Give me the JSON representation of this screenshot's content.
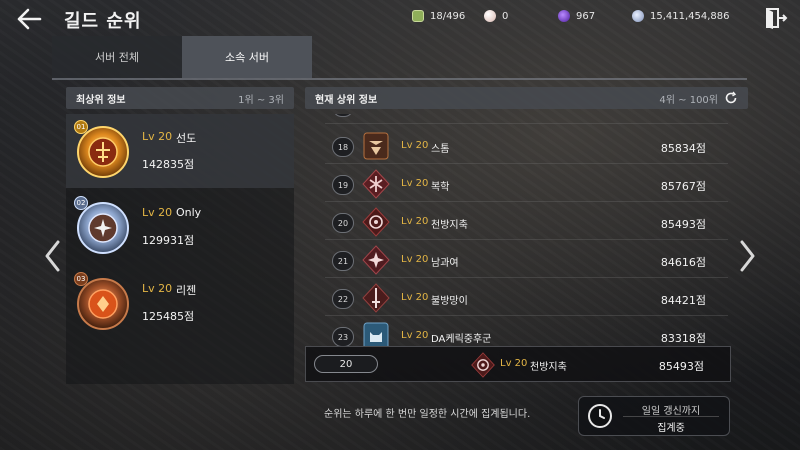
{
  "header": {
    "title": "길드 순위",
    "resources": [
      {
        "icon": "guild-member-icon",
        "value": "18/496",
        "color": "#8fae5a"
      },
      {
        "icon": "pearl-icon",
        "value": "0",
        "color": "#e8d7d2"
      },
      {
        "icon": "purple-gem-icon",
        "value": "967",
        "color": "#7a3fcf"
      },
      {
        "icon": "silver-coin-icon",
        "value": "15,411,454,886",
        "color": "#a9b8d6"
      }
    ]
  },
  "tabs": [
    {
      "label": "서버 전체",
      "active": false
    },
    {
      "label": "소속 서버",
      "active": true
    }
  ],
  "top_panel": {
    "title": "최상위 정보",
    "range": "1위 ~ 3위",
    "entries": [
      {
        "rank": "01",
        "level": "Lv 20",
        "name": "선도",
        "score": "142835점",
        "emblem": "gold-emblem-icon"
      },
      {
        "rank": "02",
        "level": "Lv 20",
        "name": "Only",
        "score": "129931점",
        "emblem": "silver-emblem-icon"
      },
      {
        "rank": "03",
        "level": "Lv 20",
        "name": "리젠",
        "score": "125485점",
        "emblem": "bronze-emblem-icon"
      }
    ]
  },
  "ranking_panel": {
    "title": "현재 상위 정보",
    "range": "4위 ~ 100위",
    "partial_top_rank": "18",
    "rows": [
      {
        "rank": "18",
        "level": "Lv 20",
        "name": "스톰",
        "score": "85834점",
        "emblem": "storm-emblem-icon"
      },
      {
        "rank": "19",
        "level": "Lv 20",
        "name": "복학",
        "score": "85767점",
        "emblem": "crest-emblem-icon"
      },
      {
        "rank": "20",
        "level": "Lv 20",
        "name": "천방지축",
        "score": "85493점",
        "emblem": "flower-emblem-icon"
      },
      {
        "rank": "21",
        "level": "Lv 20",
        "name": "남과여",
        "score": "84616점",
        "emblem": "star-emblem-icon"
      },
      {
        "rank": "22",
        "level": "Lv 20",
        "name": "불방망이",
        "score": "84421점",
        "emblem": "sword-emblem-icon"
      },
      {
        "rank": "23",
        "level": "Lv 20",
        "name": "DA케릭중후군",
        "score": "83318점",
        "emblem": "cat-emblem-icon"
      }
    ]
  },
  "my_guild": {
    "rank": "20",
    "level": "Lv 20",
    "name": "천방지축",
    "score": "85493점"
  },
  "footer": {
    "notice": "순위는 하루에 한 번만 일정한 시간에 집계됩니다.",
    "timer_label": "일일 갱신까지",
    "timer_status": "집계중"
  }
}
